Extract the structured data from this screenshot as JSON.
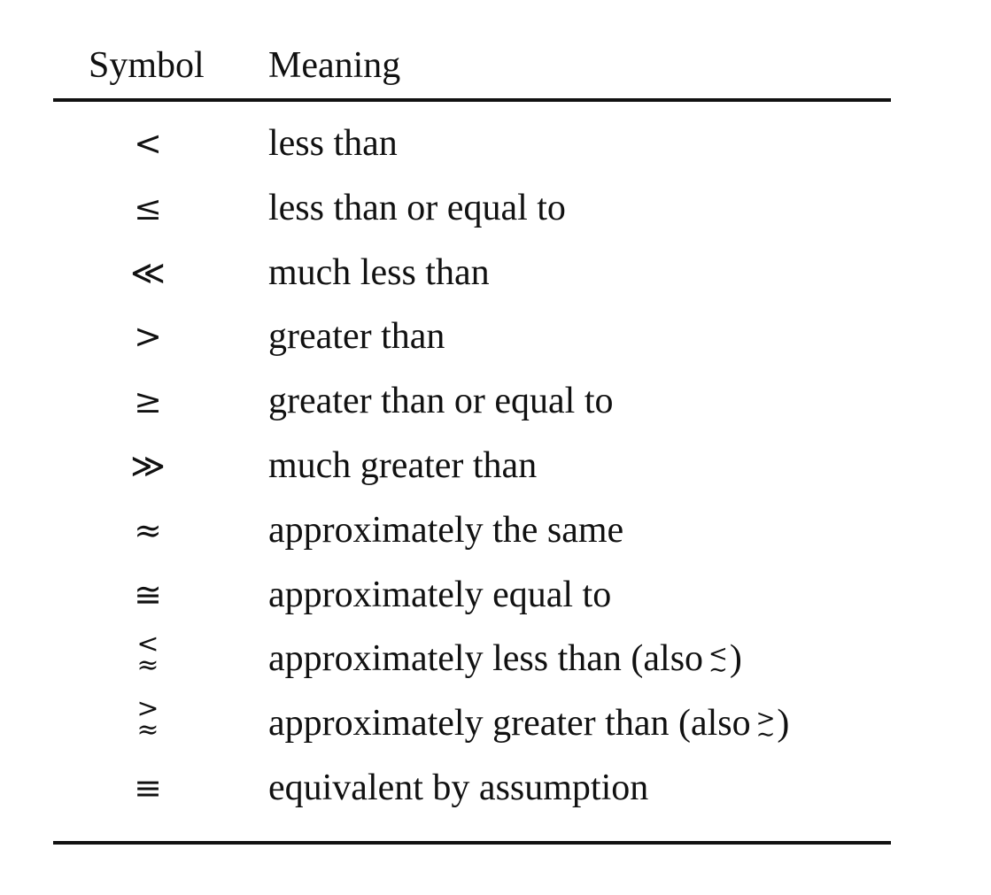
{
  "table": {
    "header": {
      "symbol": "Symbol",
      "meaning": "Meaning"
    },
    "rows": [
      {
        "symbol": "<",
        "meaning": "less than"
      },
      {
        "symbol": "≤",
        "meaning": "less than or equal to"
      },
      {
        "symbol": "≪",
        "meaning": "much less than"
      },
      {
        "symbol": ">",
        "meaning": "greater than"
      },
      {
        "symbol": "≥",
        "meaning": "greater than or equal to"
      },
      {
        "symbol": "≫",
        "meaning": "much greater than"
      },
      {
        "symbol": "≈",
        "meaning": "approximately the same"
      },
      {
        "symbol": "≅",
        "meaning": "approximately equal to"
      },
      {
        "symbol_top": "<",
        "symbol_bottom": "≈",
        "meaning": "approximately less than (also",
        "alt_top": "<",
        "alt_bottom": "∼",
        "meaning_close": ")"
      },
      {
        "symbol_top": ">",
        "symbol_bottom": "≈",
        "meaning": "approximately greater than (also",
        "alt_top": ">",
        "alt_bottom": "∼",
        "meaning_close": ")"
      },
      {
        "symbol": "≡",
        "meaning": "equivalent by assumption"
      }
    ]
  }
}
